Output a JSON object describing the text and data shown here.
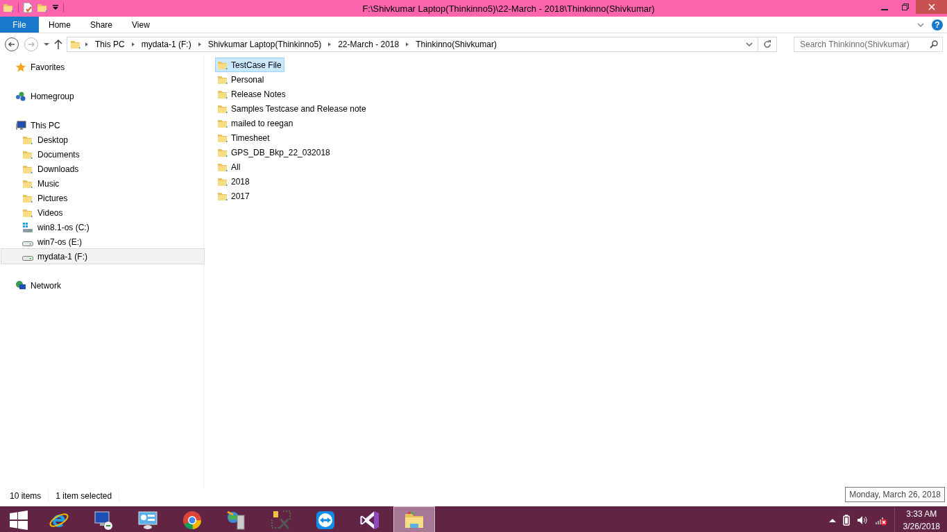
{
  "window": {
    "title": "F:\\Shivkumar Laptop(Thinkinno5)\\22-March - 2018\\Thinkinno(Shivkumar)"
  },
  "ribbon_tabs": [
    {
      "label": "File",
      "kind": "file"
    },
    {
      "label": "Home",
      "kind": "tab"
    },
    {
      "label": "Share",
      "kind": "tab"
    },
    {
      "label": "View",
      "kind": "tab"
    }
  ],
  "help": {
    "label": "?"
  },
  "address": {
    "crumbs": [
      "This PC",
      "mydata-1 (F:)",
      "Shivkumar Laptop(Thinkinno5)",
      "22-March - 2018",
      "Thinkinno(Shivkumar)"
    ]
  },
  "search": {
    "placeholder": "Search Thinkinno(Shivkumar)"
  },
  "nav": [
    {
      "label": "Favorites",
      "kind": "star",
      "selected": false
    },
    {
      "label": "Homegroup",
      "kind": "homegroup",
      "selected": false
    },
    {
      "label": "This PC",
      "kind": "pc",
      "selected": false,
      "children": [
        {
          "label": "Desktop",
          "kind": "folder",
          "selected": false
        },
        {
          "label": "Documents",
          "kind": "folder",
          "selected": false
        },
        {
          "label": "Downloads",
          "kind": "folder",
          "selected": false
        },
        {
          "label": "Music",
          "kind": "folder",
          "selected": false
        },
        {
          "label": "Pictures",
          "kind": "folder",
          "selected": false
        },
        {
          "label": "Videos",
          "kind": "folder",
          "selected": false
        },
        {
          "label": "win8.1-os (C:)",
          "kind": "osdrive",
          "selected": false
        },
        {
          "label": "win7-os (E:)",
          "kind": "drive",
          "selected": false
        },
        {
          "label": "mydata-1 (F:)",
          "kind": "drive",
          "selected": true
        }
      ]
    },
    {
      "label": "Network",
      "kind": "network",
      "selected": false
    }
  ],
  "files": [
    {
      "name": "TestCase File",
      "selected": true
    },
    {
      "name": "Personal",
      "selected": false
    },
    {
      "name": "Release Notes",
      "selected": false
    },
    {
      "name": "Samples Testcase and Release note",
      "selected": false
    },
    {
      "name": "mailed to reegan",
      "selected": false
    },
    {
      "name": "Timesheet",
      "selected": false
    },
    {
      "name": "GPS_DB_Bkp_22_032018",
      "selected": false
    },
    {
      "name": "All",
      "selected": false
    },
    {
      "name": "2018",
      "selected": false
    },
    {
      "name": "2017",
      "selected": false
    }
  ],
  "status_bar": {
    "item_count": "10 items",
    "selection": "1 item selected"
  },
  "tooltip": "Monday, March 26, 2018",
  "taskbar": {
    "apps": [
      {
        "kind": "ie",
        "selected": false
      },
      {
        "kind": "remote",
        "selected": false
      },
      {
        "kind": "control",
        "selected": false
      },
      {
        "kind": "chrome",
        "selected": false
      },
      {
        "kind": "server",
        "selected": false
      },
      {
        "kind": "tools",
        "selected": false
      },
      {
        "kind": "teamviewer",
        "selected": false
      },
      {
        "kind": "vs",
        "selected": false
      },
      {
        "kind": "explorer",
        "selected": true
      }
    ],
    "clock": {
      "time": "3:33 AM",
      "date": "3/26/2018"
    }
  }
}
